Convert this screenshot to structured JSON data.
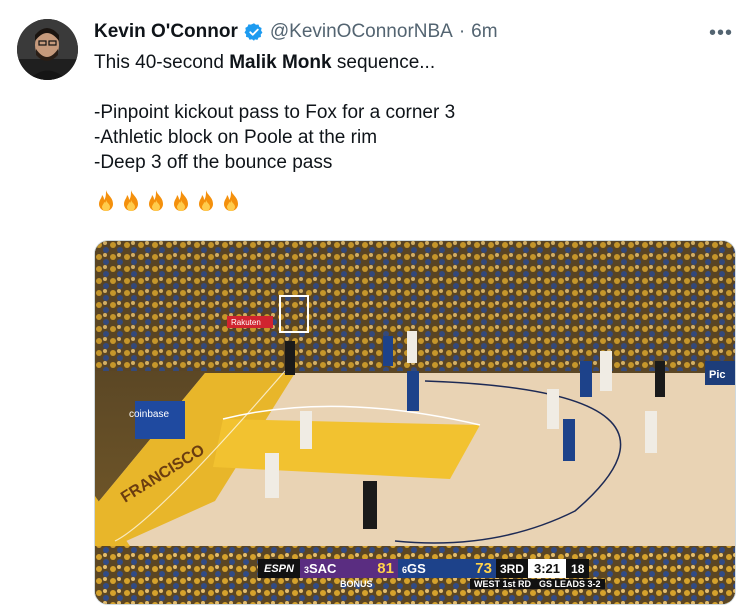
{
  "author": {
    "name": "Kevin O'Connor",
    "handle": "@KevinOConnorNBA",
    "separator": "·",
    "time": "6m",
    "verified_icon": "verified-badge-icon"
  },
  "more_label": "•••",
  "tweet": {
    "intro_prefix": "This 40-second ",
    "intro_bold": "Malik Monk",
    "intro_suffix": " sequence...",
    "bullets": [
      "-Pinpoint kickout pass to Fox for a corner 3",
      "-Athletic block on Poole at the rim",
      "-Deep 3 off the bounce pass"
    ],
    "emoji": [
      "fire-icon",
      "fire-icon",
      "fire-icon",
      "fire-icon",
      "fire-icon",
      "fire-icon"
    ]
  },
  "video": {
    "court_text_left": "FRANCISCO",
    "ads": [
      "coinbase",
      "Rakuten"
    ],
    "corner_badge": "Pic",
    "scoreboard": {
      "network": "ESPN",
      "team1_seed": "3",
      "team1": "SAC",
      "team1_score": "81",
      "team2_seed": "6",
      "team2": "GS",
      "team2_score": "73",
      "period": "3RD",
      "clock": "3:21",
      "shot_clock": "18",
      "bonus": "BONUS",
      "series": "WEST 1st RD",
      "series_status": "GS LEADS 3-2"
    }
  },
  "colors": {
    "handle_gray": "#536471",
    "verified_blue": "#1d9bf0",
    "court_gold": "#f2c230",
    "kings_purple": "#5a2d81",
    "warriors_blue": "#1d428a"
  }
}
